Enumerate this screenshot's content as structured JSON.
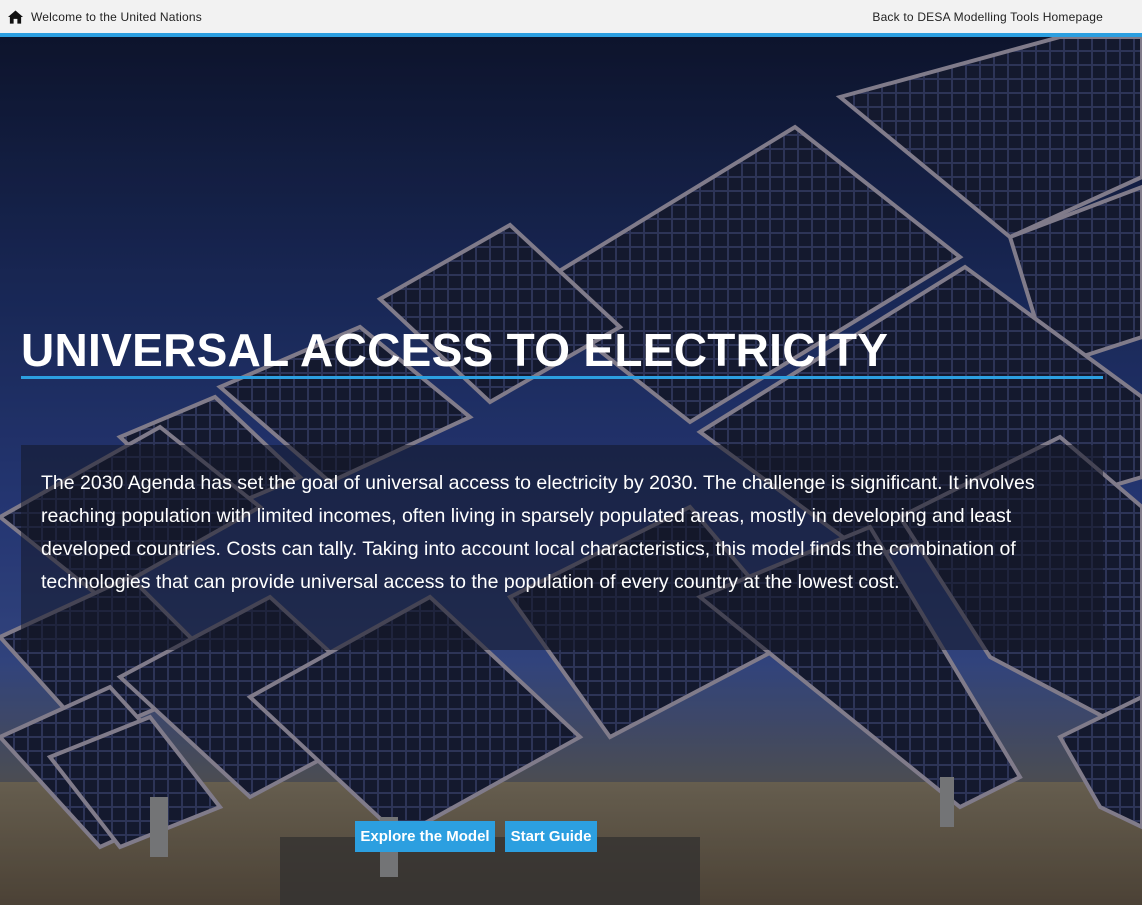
{
  "topbar": {
    "home_icon": "home-icon",
    "welcome_text": "Welcome to the United Nations",
    "back_link": "Back to DESA Modelling Tools Homepage"
  },
  "hero": {
    "title": "UNIVERSAL ACCESS TO ELECTRICITY",
    "description": "The 2030 Agenda has set the goal of universal access to electricity by 2030. The challenge is significant. It involves reaching population with limited incomes, often living in sparsely populated areas, mostly in developing and least developed countries. Costs can tally. Taking into account local characteristics, this model finds the combination of technologies that can provide universal access to the population of every country at the lowest cost.",
    "background_image": "solar-panels-photo"
  },
  "buttons": {
    "explore": "Explore the Model",
    "guide": "Start Guide"
  },
  "colors": {
    "accent": "#2c9fe0",
    "topbar_bg": "#f2f2f2"
  }
}
